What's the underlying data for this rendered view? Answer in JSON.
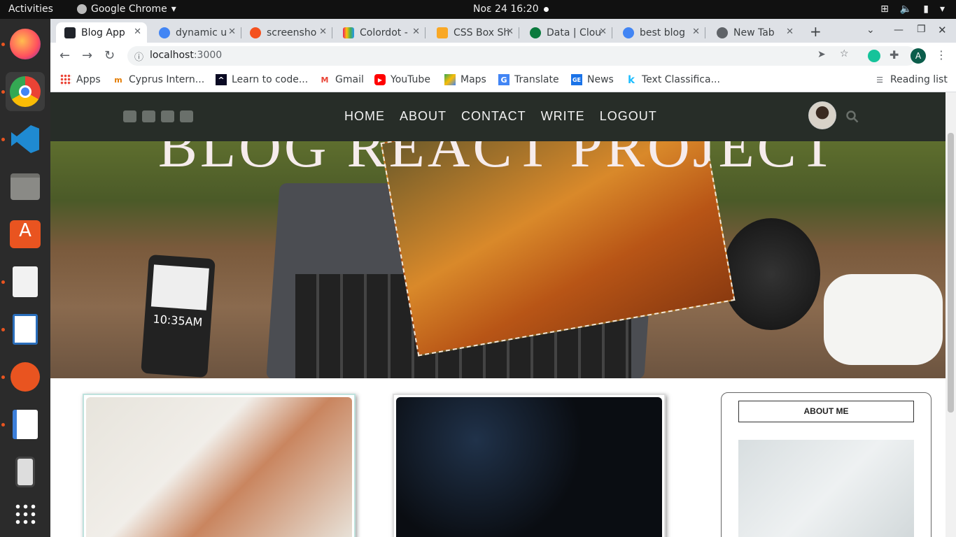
{
  "os": {
    "activities": "Activities",
    "app_name": "Google Chrome",
    "clock": "Νοε 24  16:20"
  },
  "dock": [
    "firefox",
    "chrome",
    "vscode",
    "files",
    "software-center",
    "text-editor",
    "libreoffice-writer",
    "inkscape",
    "notes",
    "media",
    "app-grid"
  ],
  "browser": {
    "tabs": [
      {
        "title": "Blog App",
        "active": true,
        "color": "#20232a"
      },
      {
        "title": "dynamic u",
        "color": "#4285f4"
      },
      {
        "title": "screensho",
        "color": "#f4511e"
      },
      {
        "title": "Colordot -",
        "color": "#e91e63"
      },
      {
        "title": "CSS Box Sh",
        "color": "#f9a825"
      },
      {
        "title": "Data | Clou",
        "color": "#0b7a3e"
      },
      {
        "title": "best blog ",
        "color": "#4285f4"
      },
      {
        "title": "New Tab",
        "color": "#5f6368"
      }
    ],
    "url_host": "localhost",
    "url_port": ":3000",
    "profile_initial": "A",
    "bookmarks": [
      {
        "label": "Apps"
      },
      {
        "label": "Cyprus Intern..."
      },
      {
        "label": "Learn to code..."
      },
      {
        "label": "Gmail"
      },
      {
        "label": "YouTube"
      },
      {
        "label": "Maps"
      },
      {
        "label": "Translate"
      },
      {
        "label": "News"
      },
      {
        "label": "Text Classifica..."
      }
    ],
    "reading_list": "Reading list"
  },
  "site": {
    "nav": [
      "HOME",
      "ABOUT",
      "CONTACT",
      "WRITE",
      "LOGOUT"
    ],
    "hero_title": "BLOG REACT PROJECT",
    "phone_time": "10:35AM",
    "sidebar_heading": "ABOUT ME"
  }
}
